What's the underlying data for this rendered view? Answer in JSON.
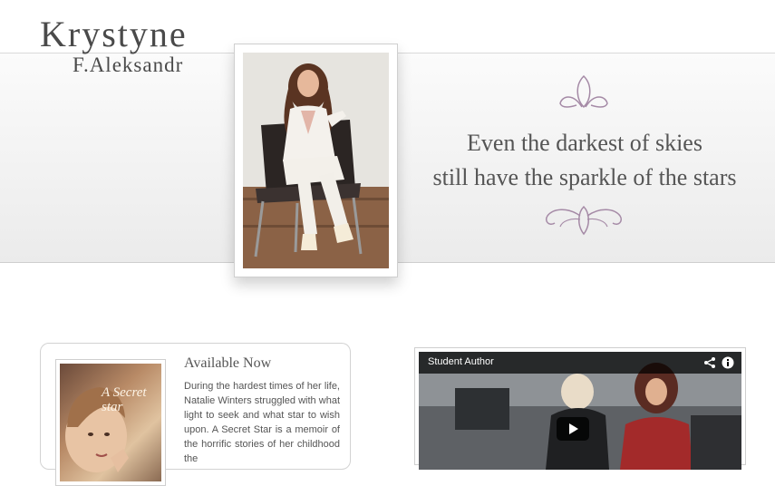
{
  "logo": {
    "line1": "Krystyne",
    "line2": "F.Aleksandr"
  },
  "quote": {
    "line1": "Even the darkest of skies",
    "line2": "still have the sparkle of the stars"
  },
  "book": {
    "heading": "Available Now",
    "description": "During the hardest times of her life, Natalie Winters struggled with what light to seek and what star to wish upon. A Secret Star is a memoir of the horrific stories of her childhood the",
    "cover_title": "A Secret star"
  },
  "video": {
    "title": "Student Author",
    "icons": [
      "share-icon",
      "info-icon",
      "play-icon"
    ]
  },
  "colors": {
    "text": "#555555",
    "ornament": "#a58aa6",
    "banner": "#ececec"
  }
}
